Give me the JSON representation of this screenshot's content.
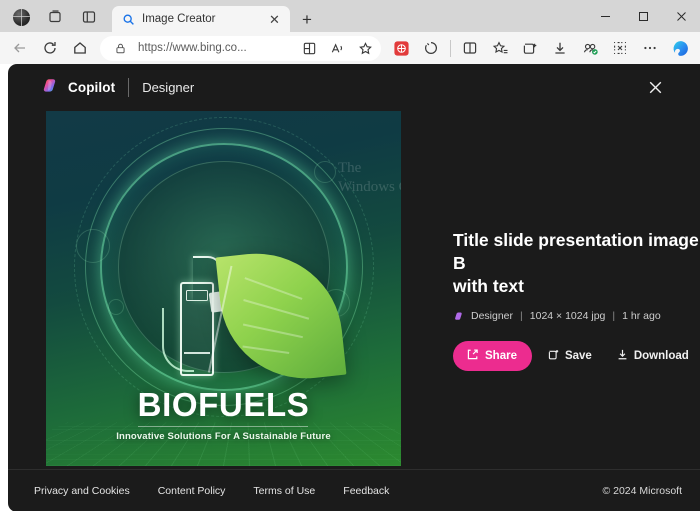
{
  "browser": {
    "sys_icons": [
      "globe-icon",
      "workspaces-icon",
      "tab-actions-icon"
    ],
    "tab": {
      "title": "Image Creator",
      "favicon": "search-icon",
      "close_label": "✕"
    },
    "new_tab_label": "+",
    "window_controls": {
      "minimize": "─",
      "maximize": "□",
      "close": "✕"
    },
    "nav": {
      "back": "back-arrow-icon",
      "refresh": "refresh-icon",
      "home": "home-icon"
    },
    "omnibox": {
      "url": "https://www.bing.co...",
      "lock": "lock-icon",
      "split_screen": "split-screen-icon",
      "read_aloud": "read-aloud-icon",
      "favorite": "star-icon"
    },
    "toolbar_icons": [
      "shopping-icon",
      "browser-essentials-icon",
      "split-screen-icon",
      "favorites-icon",
      "collections-icon",
      "downloads-icon",
      "profile-icon",
      "screenshot-icon",
      "settings-more-icon",
      "copilot-icon"
    ]
  },
  "modal": {
    "brand": "Copilot",
    "section": "Designer",
    "close": "✕",
    "next_arrow": "chevron-right-icon"
  },
  "image": {
    "headline": "BIOFUELS",
    "tagline": "Innovative Solutions For A Sustainable Future",
    "watermark_line1": "The",
    "watermark_line2": "Windows Club",
    "alt": "fuel-pump-and-leaf-illustration"
  },
  "details": {
    "title": "Title slide presentation image for B\nwith text",
    "creator": "Designer",
    "dimensions": "1024 × 1024 jpg",
    "age": "1 hr ago",
    "sep": "|"
  },
  "actions": {
    "share": "Share",
    "save": "Save",
    "download": "Download",
    "edit": "edit-icon",
    "share_color": "#ec2c8f"
  },
  "footer": {
    "links": [
      "Privacy and Cookies",
      "Content Policy",
      "Terms of Use",
      "Feedback"
    ],
    "copyright": "© 2024 Microsoft"
  }
}
